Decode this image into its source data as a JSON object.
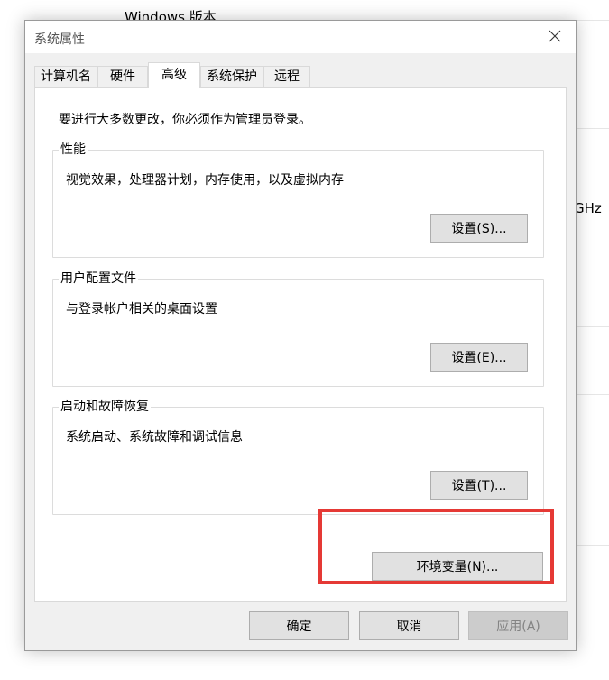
{
  "background": {
    "windows_edition_heading": "Windows 版本",
    "cpu_freq_fragment": "GHz"
  },
  "dialog": {
    "title": "系统属性",
    "tabs": [
      {
        "label": "计算机名"
      },
      {
        "label": "硬件"
      },
      {
        "label": "高级",
        "active": true
      },
      {
        "label": "系统保护"
      },
      {
        "label": "远程"
      }
    ],
    "notice": "要进行大多数更改，你必须作为管理员登录。",
    "groups": {
      "performance": {
        "label": "性能",
        "description": "视觉效果，处理器计划，内存使用，以及虚拟内存",
        "button": "设置(S)..."
      },
      "user_profiles": {
        "label": "用户配置文件",
        "description": "与登录帐户相关的桌面设置",
        "button": "设置(E)..."
      },
      "startup_recovery": {
        "label": "启动和故障恢复",
        "description": "系统启动、系统故障和调试信息",
        "button": "设置(T)..."
      }
    },
    "env_vars_button": "环境变量(N)...",
    "footer": {
      "ok": "确定",
      "cancel": "取消",
      "apply": "应用(A)"
    }
  },
  "colors": {
    "highlight_border": "#e53935",
    "dialog_bg": "#f0f0f0",
    "button_bg": "#e1e1e1"
  }
}
